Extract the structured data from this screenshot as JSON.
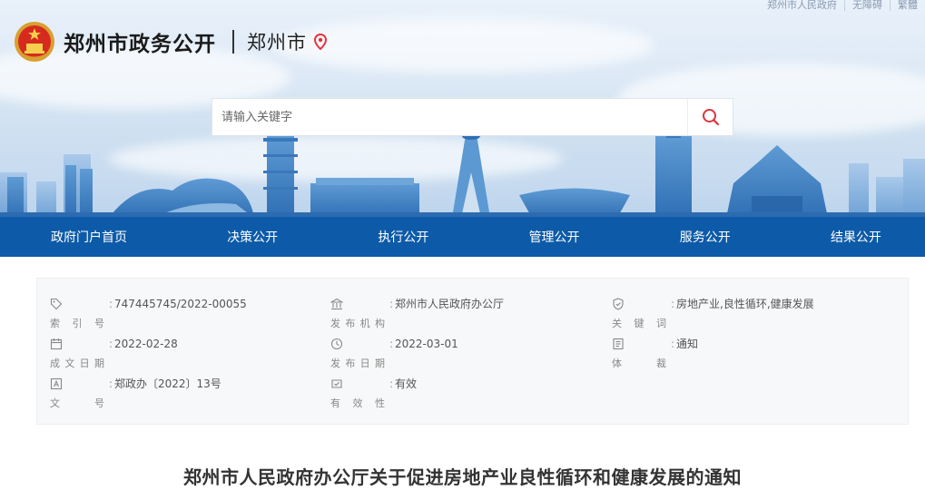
{
  "topbar": {
    "links": [
      "郑州市人民政府",
      "无障碍",
      "繁體"
    ]
  },
  "header": {
    "site_title": "郑州市政务公开",
    "city": "郑州市"
  },
  "search": {
    "placeholder": "请输入关键字"
  },
  "nav": {
    "items": [
      "政府门户首页",
      "决策公开",
      "执行公开",
      "管理公开",
      "服务公开",
      "结果公开"
    ]
  },
  "info": {
    "index_no": {
      "label": "索引号",
      "value": "747445745/2022-00055"
    },
    "publisher": {
      "label": "发布机构",
      "value": "郑州市人民政府办公厅"
    },
    "keywords": {
      "label": "关键词",
      "value": "房地产业,良性循环,健康发展"
    },
    "created": {
      "label": "成文日期",
      "value": "2022-02-28"
    },
    "published": {
      "label": "发布日期",
      "value": "2022-03-01"
    },
    "carrier": {
      "label": "体裁",
      "value": "通知"
    },
    "doc_no": {
      "label": "文号",
      "value": "郑政办〔2022〕13号"
    },
    "validity": {
      "label": "有效性",
      "value": "有效"
    }
  },
  "document": {
    "title": "郑州市人民政府办公厅关于促进房地产业良性循环和健康发展的通知"
  },
  "colors": {
    "nav_bg": "#0d5ba8",
    "pin": "#e8323c",
    "search_icon": "#d9363e"
  },
  "icons": [
    "emblem-icon",
    "location-pin-icon",
    "search-icon",
    "tag-icon",
    "bank-icon",
    "shield-icon",
    "calendar-icon",
    "clock-icon",
    "book-icon",
    "doc-letter-icon",
    "badge-check-icon"
  ]
}
